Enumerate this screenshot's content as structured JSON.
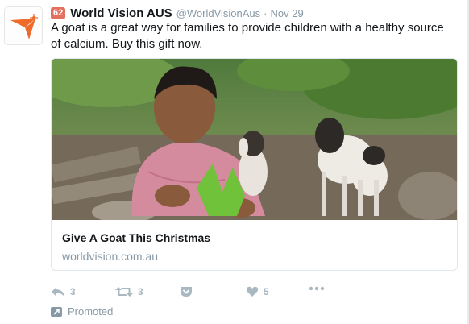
{
  "tweet": {
    "author_name": "World Vision AUS",
    "rank_badge": "62",
    "handle": "@WorldVisionAus",
    "separator": "·",
    "timestamp": "Nov 29",
    "text": "A goat is a great way for families to provide children with a healthy source of calcium. Buy this gift now."
  },
  "card": {
    "title": "Give A Goat This Christmas",
    "domain": "worldvision.com.au"
  },
  "actions": {
    "reply_count": "3",
    "retweet_count": "3",
    "like_count": "5"
  },
  "promoted_label": "Promoted",
  "colors": {
    "brand_orange": "#ee6b2b",
    "muted": "#aab8c2",
    "secondary_text": "#8899a6",
    "badge": "#e3705e"
  },
  "icons": {
    "avatar": "world-vision-logo",
    "reply": "reply-icon",
    "retweet": "retweet-icon",
    "pocket": "save-icon",
    "like": "heart-icon",
    "more": "more-icon",
    "promoted": "promoted-arrow-icon"
  }
}
